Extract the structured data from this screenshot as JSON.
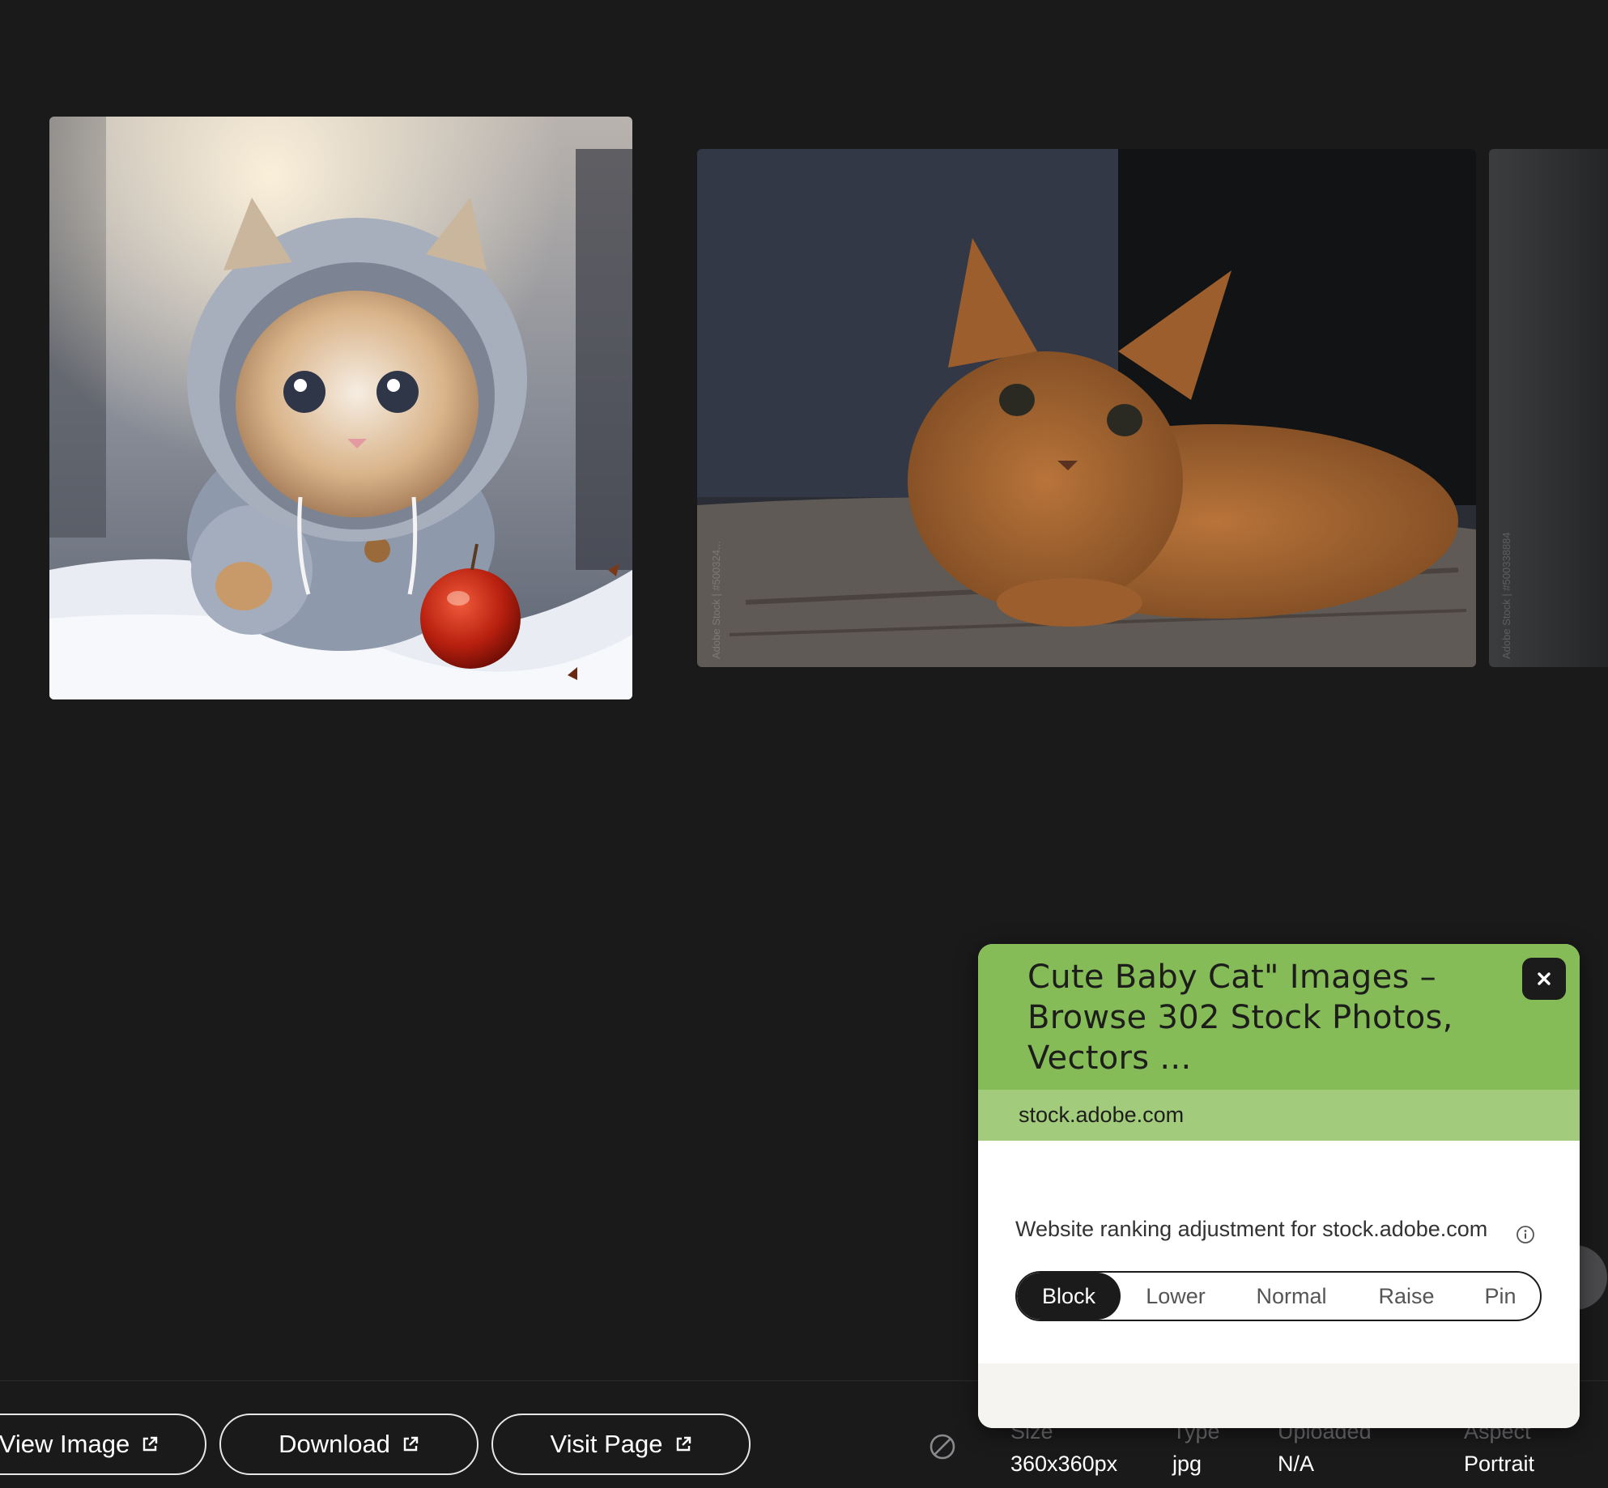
{
  "images": {
    "main": {
      "icon": "kitten-in-hoodie-image"
    },
    "related": [
      {
        "icon": "orange-kitten-image",
        "watermark": "Adobe Stock | #500324..."
      },
      {
        "icon": "partial-image",
        "watermark": "Adobe Stock | #500338884"
      }
    ]
  },
  "actions": {
    "view_image": "View Image",
    "download": "Download",
    "visit_page": "Visit Page"
  },
  "metadata": {
    "size_label": "Size",
    "size_value": "360x360px",
    "type_label": "Type",
    "type_value": "jpg",
    "uploaded_label": "Uploaded",
    "uploaded_value": "N/A",
    "aspect_label": "Aspect",
    "aspect_value": "Portrait"
  },
  "popup": {
    "title": "Cute Baby Cat\" Images – Browse 302 Stock Photos, Vectors ...",
    "domain": "stock.adobe.com",
    "ranking_label": "Website ranking adjustment for stock.adobe.com",
    "options": [
      "Block",
      "Lower",
      "Normal",
      "Raise",
      "Pin"
    ],
    "selected_option": "Block"
  },
  "colors": {
    "background": "#1a1a1b",
    "popup_header": "#86bc57",
    "popup_domain_bar": "#a2cb7b",
    "segment_active": "#1b1b1b"
  }
}
